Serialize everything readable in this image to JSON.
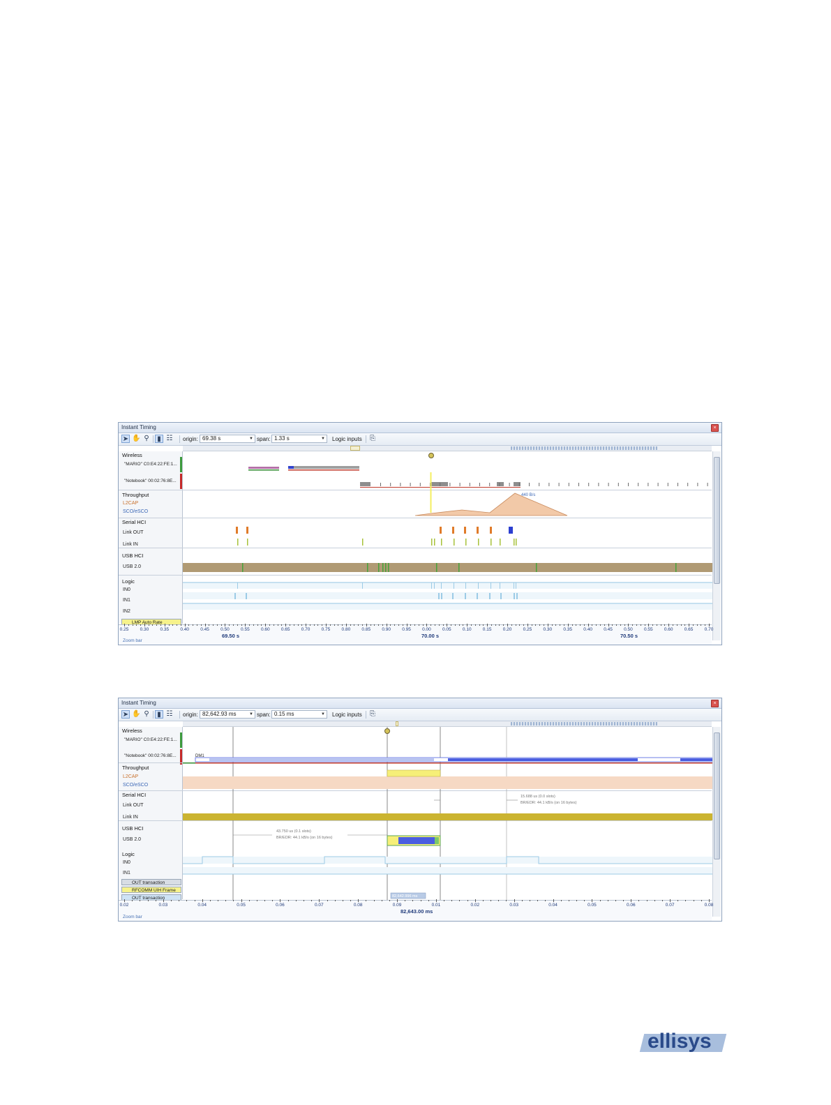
{
  "window1": {
    "title": "Instant Timing",
    "toolbar": {
      "origin_label": "origin:",
      "origin_value": "69.38 s",
      "span_label": "span:",
      "span_value": "1.33 s",
      "logic_inputs": "Logic inputs"
    },
    "labels": {
      "wireless": "Wireless",
      "device1": "\"MARIO\" C0:E4:22:FE:1...",
      "device2": "\"Notebook\" 00:02:76:8E...",
      "throughput": "Throughput",
      "l2cap": "L2CAP",
      "sco": "SCO/eSCO",
      "serial_hci": "Serial HCI",
      "link_out": "Link OUT",
      "link_in": "Link IN",
      "usb_hci": "USB HCI",
      "usb20": "USB 2.0",
      "logic": "Logic",
      "in0": "IN0",
      "in1": "IN1",
      "in2": "IN2"
    },
    "side_buttons": [
      "LMP Auto Rate"
    ],
    "throughput_annotation": "440 B/s",
    "axis": {
      "ticks": [
        "0.25",
        "0.30",
        "0.35",
        "0.40",
        "0.45",
        "0.50",
        "0.55",
        "0.60",
        "0.65",
        "0.70",
        "0.75",
        "0.80",
        "0.85",
        "0.90",
        "0.95",
        "0.00",
        "0.05",
        "0.10",
        "0.15",
        "0.20",
        "0.25",
        "0.30",
        "0.35",
        "0.40",
        "0.45",
        "0.50",
        "0.55",
        "0.60",
        "0.65",
        "0.70"
      ],
      "majors": [
        {
          "text": "69.50",
          "unit": "s"
        },
        {
          "text": "70.00",
          "unit": "s"
        },
        {
          "text": "70.50",
          "unit": "s"
        }
      ],
      "zoom_bar": "Zoom bar"
    },
    "colors": {
      "usb_band": "#b09a74",
      "link_out": "#e07b2a",
      "link_in": "#a7c23a",
      "throughput_fill": "#f2c9a8"
    }
  },
  "window2": {
    "title": "Instant Timing",
    "toolbar": {
      "origin_label": "origin:",
      "origin_value": "82,642.93 ms",
      "span_label": "span:",
      "span_value": "0.15 ms",
      "logic_inputs": "Logic inputs"
    },
    "labels": {
      "wireless": "Wireless",
      "device1": "\"MARIO\" C0:E4:22:FE:1...",
      "device2": "\"Notebook\" 00:02:76:8E...",
      "throughput": "Throughput",
      "l2cap": "L2CAP",
      "sco": "SCO/eSCO",
      "serial_hci": "Serial HCI",
      "link_out": "Link OUT",
      "link_in": "Link IN",
      "usb_hci": "USB HCI",
      "usb20": "USB 2.0",
      "logic": "Logic",
      "in0": "IN0",
      "in1": "IN1"
    },
    "side_buttons": [
      "OUT transaction",
      "RFCOMM UIH Frame",
      "OUT transaction"
    ],
    "packet_label": "DM1",
    "measure1": {
      "line1": "15.688 us (0.0 slots)",
      "line2": "BR/EDR:  44.1 kB/s (on 16 bytes)"
    },
    "measure2": {
      "line1": "43.750 us (0.1 slots)",
      "line2": "BR/EDR:  44.1 kB/s (on 16 bytes)"
    },
    "cursor_readout": "82,642.996 ms",
    "axis": {
      "ticks": [
        "0.02",
        "0.03",
        "0.04",
        "0.05",
        "0.06",
        "0.07",
        "0.08",
        "0.09",
        "0.01",
        "0.02",
        "0.03",
        "0.04",
        "0.05",
        "0.06",
        "0.07",
        "0.08"
      ],
      "majors": [
        {
          "text": "82,643.00",
          "unit": "ms"
        }
      ],
      "zoom_bar": "Zoom bar"
    },
    "colors": {
      "link_in_band": "#cbb431",
      "l2cap_band": "#f6d9c4",
      "usb_blue": "#4a5ee0"
    }
  },
  "logo": "ellisys"
}
